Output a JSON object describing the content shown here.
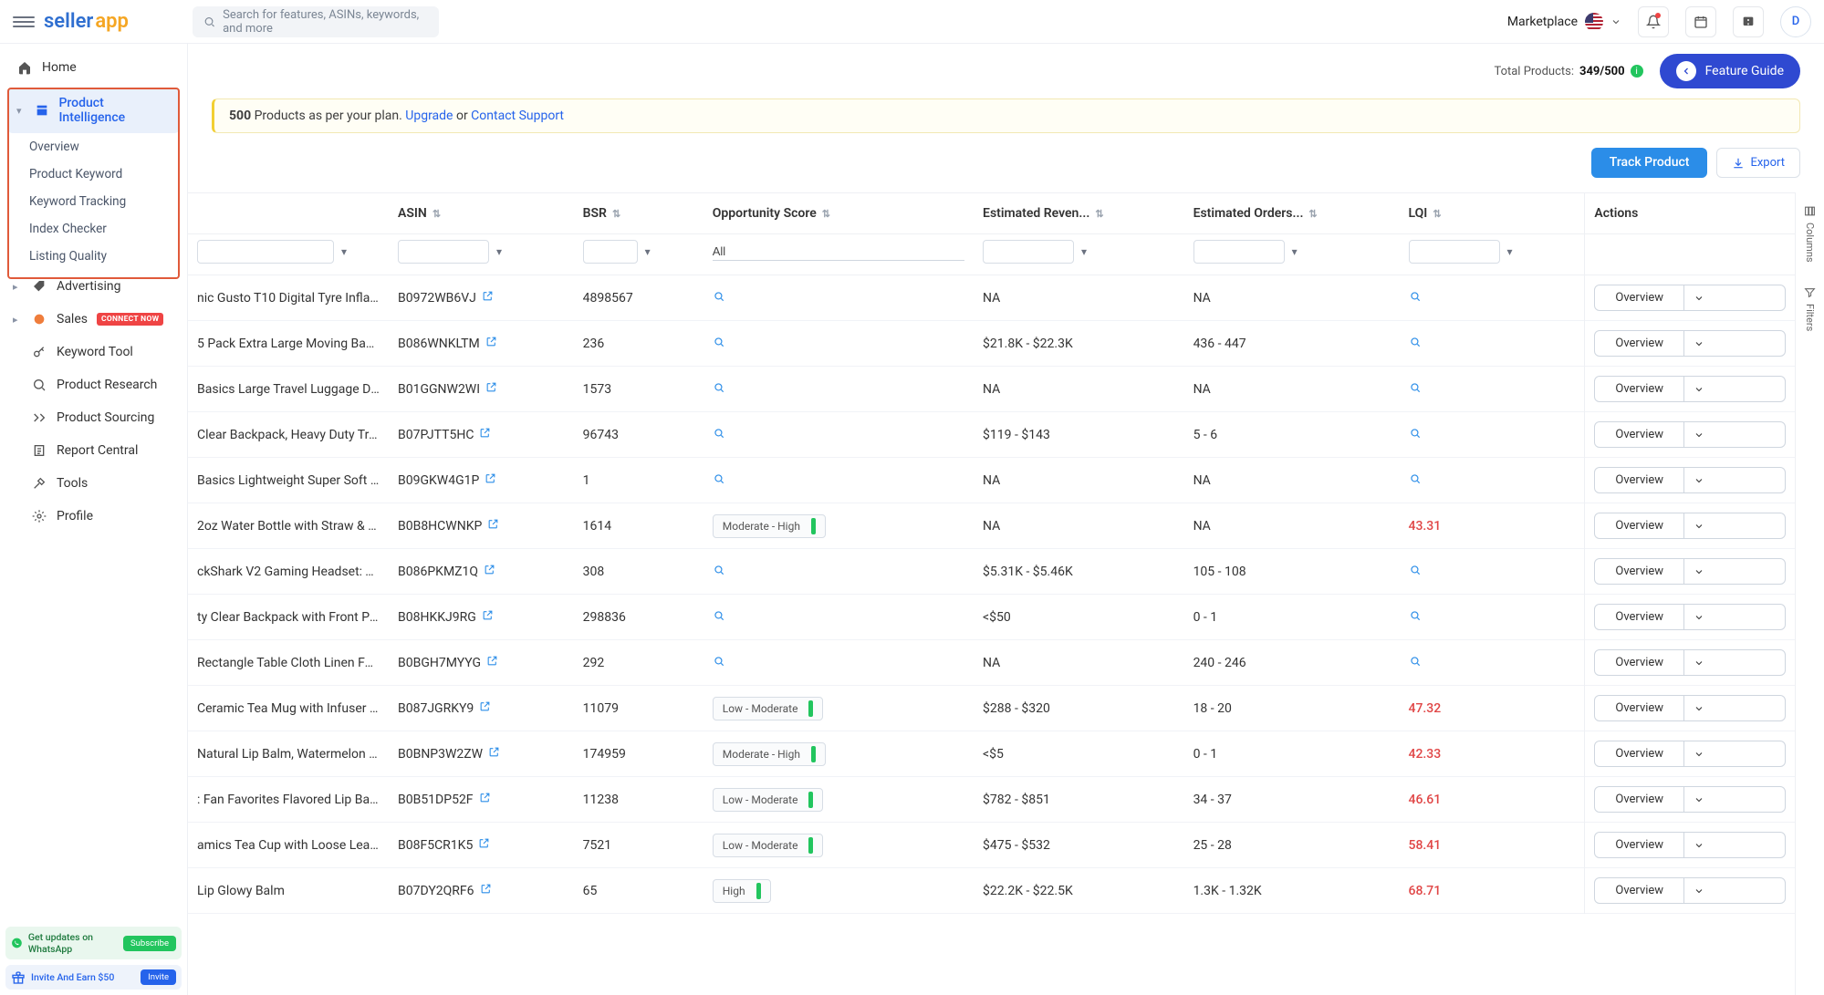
{
  "header": {
    "logo_seller": "seller",
    "logo_app": "app",
    "search_placeholder": "Search for features, ASINs, keywords, and more",
    "marketplace_label": "Marketplace",
    "avatar_letter": "D"
  },
  "sidebar": {
    "home": "Home",
    "product_intelligence": "Product Intelligence",
    "pi_items": [
      "Overview",
      "Product Keyword",
      "Keyword Tracking",
      "Index Checker",
      "Listing Quality"
    ],
    "advertising": "Advertising",
    "sales": "Sales",
    "connect_now": "CONNECT NOW",
    "keyword_tool": "Keyword Tool",
    "product_research": "Product Research",
    "product_sourcing": "Product Sourcing",
    "report_central": "Report Central",
    "tools": "Tools",
    "profile": "Profile",
    "whatsapp_text": "Get updates on WhatsApp",
    "subscribe_btn": "Subscribe",
    "invite_text": "Invite And Earn $50",
    "invite_btn": "Invite"
  },
  "breadcrumb": {
    "total_products_label": "Total Products:",
    "total_products_value": "349/500",
    "feature_guide": "Feature Guide"
  },
  "banner": {
    "text_prefix": "500",
    "text_mid": " Products as per your plan. ",
    "upgrade": "Upgrade",
    "or": " or ",
    "contact": "Contact Support"
  },
  "actions": {
    "track": "Track Product",
    "export": "Export"
  },
  "columns": {
    "asin": "ASIN",
    "bsr": "BSR",
    "opportunity": "Opportunity Score",
    "revenue": "Estimated Reven...",
    "orders": "Estimated Orders...",
    "lqi": "LQI",
    "actions": "Actions"
  },
  "filter": {
    "opportunity_all": "All"
  },
  "rails": {
    "columns": "Columns",
    "filters": "Filters"
  },
  "action_label": "Overview",
  "rows": [
    {
      "product": "nic Gusto T10 Digital Tyre Inflator - ...",
      "asin": "B0972WB6VJ",
      "bsr": "4898567",
      "opp": "",
      "revenue": "NA",
      "orders": "NA",
      "lqi": ""
    },
    {
      "product": "5 Pack Extra Large Moving Bags wit...",
      "asin": "B086WNKLTM",
      "bsr": "236",
      "opp": "",
      "revenue": "$21.8K - $22.3K",
      "orders": "436 - 447",
      "lqi": ""
    },
    {
      "product": "Basics Large Travel Luggage Duffel ...",
      "asin": "B01GGNW2WI",
      "bsr": "1573",
      "opp": "",
      "revenue": "NA",
      "orders": "NA",
      "lqi": ""
    },
    {
      "product": "Clear Backpack, Heavy Duty Trans...",
      "asin": "B07PJTT5HC",
      "bsr": "96743",
      "opp": "",
      "revenue": "$119 - $143",
      "orders": "5 - 6",
      "lqi": ""
    },
    {
      "product": "Basics Lightweight Super Soft Easy ...",
      "asin": "B09GKW4G1P",
      "bsr": "1",
      "opp": "",
      "revenue": "NA",
      "orders": "NA",
      "lqi": ""
    },
    {
      "product": "2oz Water Bottle with Straw & Moti...",
      "asin": "B0B8HCWNKP",
      "bsr": "1614",
      "opp": "Moderate - High",
      "revenue": "NA",
      "orders": "NA",
      "lqi": "43.31"
    },
    {
      "product": "ckShark V2 Gaming Headset: THX 7...",
      "asin": "B086PKMZ1Q",
      "bsr": "308",
      "opp": "",
      "revenue": "$5.31K - $5.46K",
      "orders": "105 - 108",
      "lqi": ""
    },
    {
      "product": "ty Clear Backpack with Front Pocke...",
      "asin": "B08HKKJ9RG",
      "bsr": "298836",
      "opp": "",
      "revenue": "<$50",
      "orders": "0 - 1",
      "lqi": ""
    },
    {
      "product": "Rectangle Table Cloth Linen Farmh...",
      "asin": "B0BGH7MYYG",
      "bsr": "292",
      "opp": "",
      "revenue": "NA",
      "orders": "240 - 246",
      "lqi": ""
    },
    {
      "product": "Ceramic Tea Mug with Infuser and ...",
      "asin": "B087JGRKY9",
      "bsr": "11079",
      "opp": "Low - Moderate",
      "revenue": "$288 - $320",
      "orders": "18 - 20",
      "lqi": "47.32"
    },
    {
      "product": "Natural Lip Balm, Watermelon Fros...",
      "asin": "B0BNP3W2ZW",
      "bsr": "174959",
      "opp": "Moderate - High",
      "revenue": "<$5",
      "orders": "0 - 1",
      "lqi": "42.33"
    },
    {
      "product": ": Fan Favorites Flavored Lip Balm Tu...",
      "asin": "B0B51DP52F",
      "bsr": "11238",
      "opp": "Low - Moderate",
      "revenue": "$782 - $851",
      "orders": "34 - 37",
      "lqi": "46.61"
    },
    {
      "product": "amics Tea Cup with Loose Leaf Infus...",
      "asin": "B08F5CR1K5",
      "bsr": "7521",
      "opp": "Low - Moderate",
      "revenue": "$475 - $532",
      "orders": "25 - 28",
      "lqi": "58.41"
    },
    {
      "product": "Lip Glowy Balm",
      "asin": "B07DY2QRF6",
      "bsr": "65",
      "opp": "High",
      "revenue": "$22.2K - $22.5K",
      "orders": "1.3K - 1.32K",
      "lqi": "68.71"
    }
  ]
}
